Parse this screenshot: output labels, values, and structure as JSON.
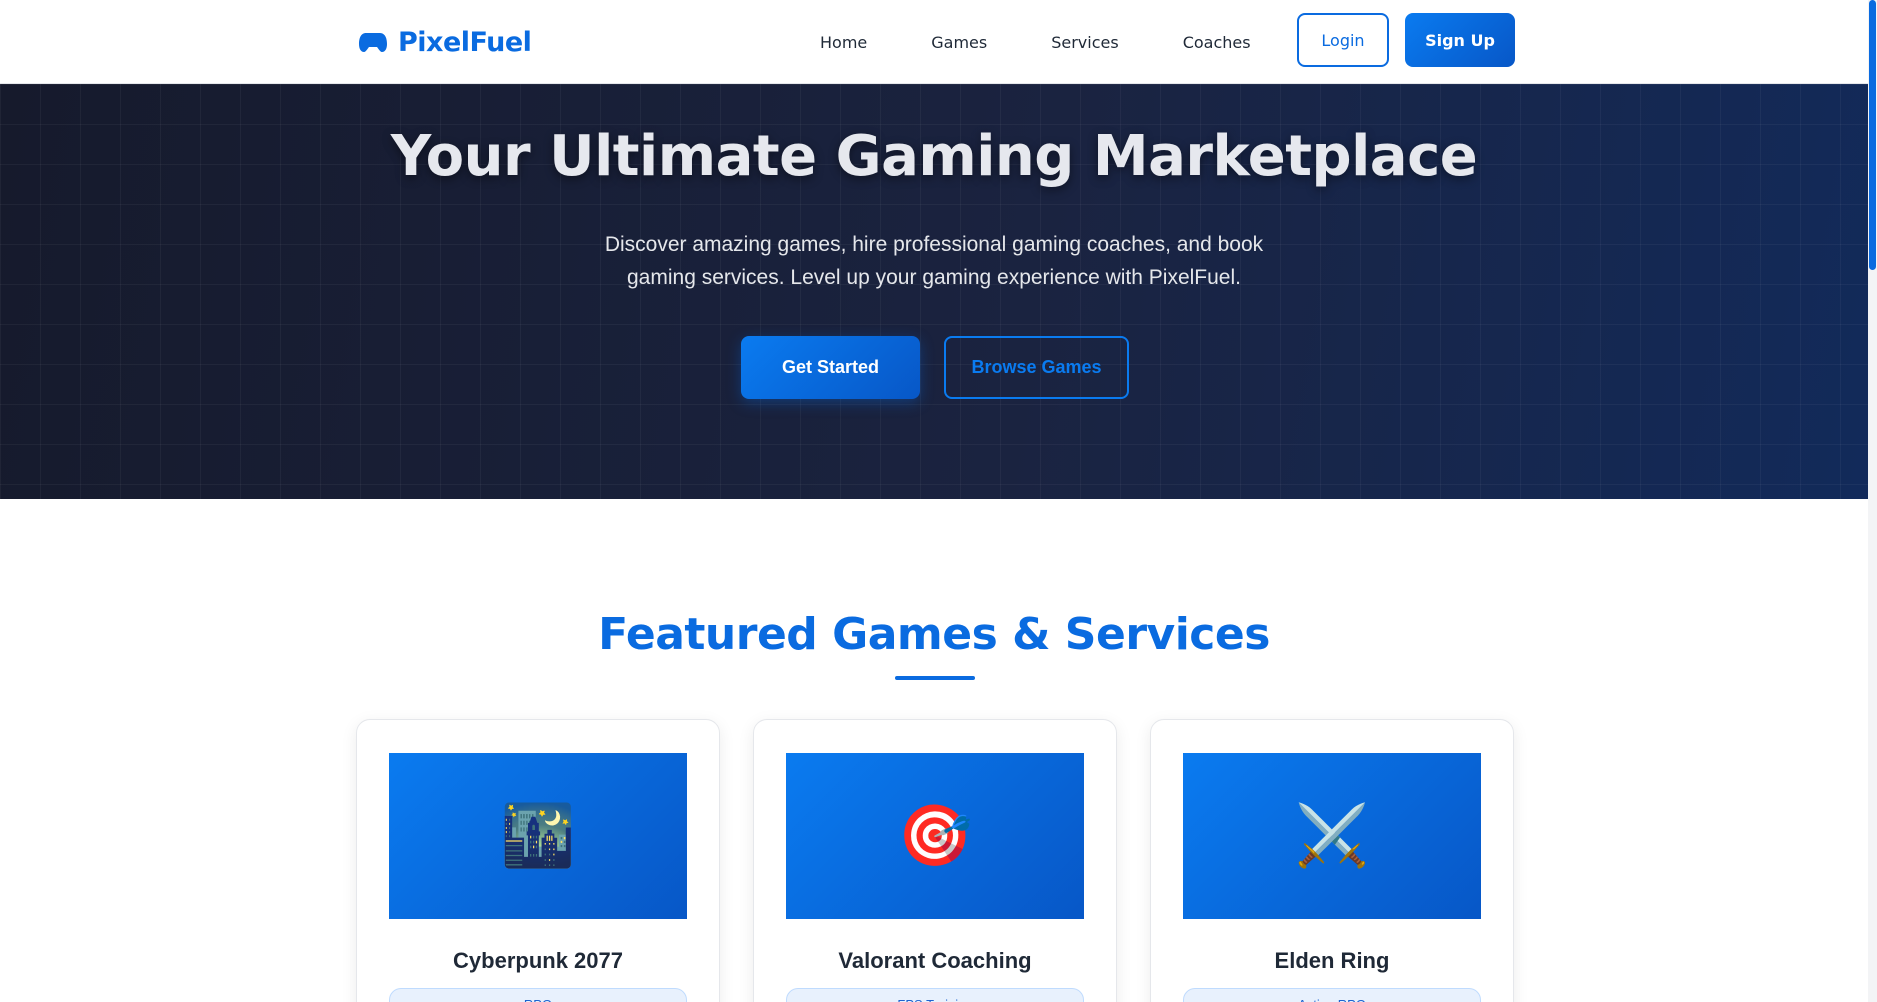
{
  "header": {
    "brand": "PixelFuel",
    "nav": [
      "Home",
      "Games",
      "Services",
      "Coaches"
    ],
    "login_label": "Login",
    "signup_label": "Sign Up"
  },
  "hero": {
    "title": "Your Ultimate Gaming Marketplace",
    "subtitle": "Discover amazing games, hire professional gaming coaches, and book gaming services. Level up your gaming experience with PixelFuel.",
    "cta_primary": "Get Started",
    "cta_secondary": "Browse Games"
  },
  "featured": {
    "title": "Featured Games & Services",
    "cards": [
      {
        "title": "Cyberpunk 2077",
        "icon": "night-city-icon",
        "emoji": "🌃",
        "tag": "RPG"
      },
      {
        "title": "Valorant Coaching",
        "icon": "target-icon",
        "emoji": "🎯",
        "tag": "FPS Training"
      },
      {
        "title": "Elden Ring",
        "icon": "crossed-swords-icon",
        "emoji": "⚔️",
        "tag": "Action RPG"
      }
    ]
  },
  "colors": {
    "accent": "#0a6be0",
    "hero_bg": "#1a2340",
    "text_dark": "#1f2937"
  }
}
